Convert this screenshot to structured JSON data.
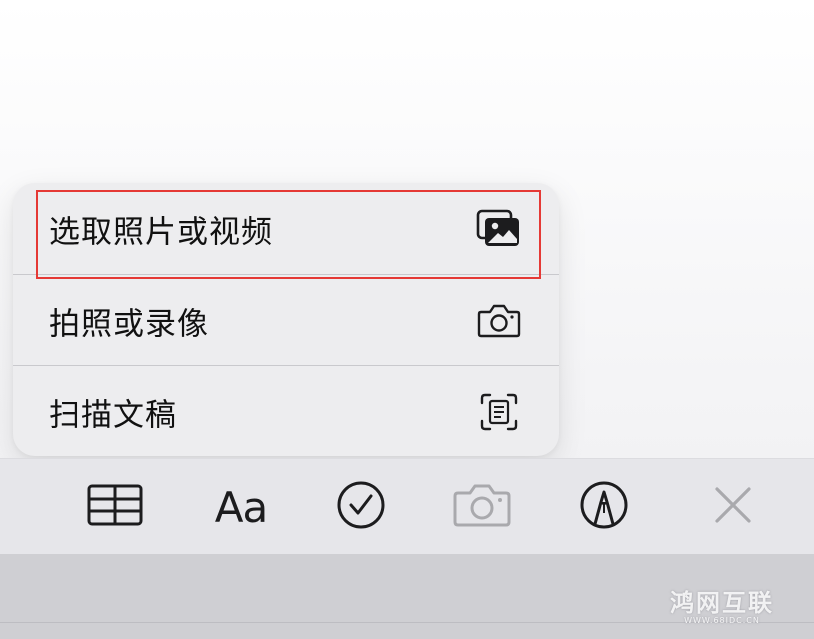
{
  "menu": {
    "items": [
      {
        "label": "选取照片或视频",
        "icon": "photo-library-icon"
      },
      {
        "label": "拍照或录像",
        "icon": "camera-icon"
      },
      {
        "label": "扫描文稿",
        "icon": "scan-document-icon"
      }
    ]
  },
  "toolbar": {
    "buttons": [
      {
        "name": "table",
        "icon": "table-icon"
      },
      {
        "name": "format",
        "icon": "text-format-icon",
        "label": "Aa"
      },
      {
        "name": "checklist",
        "icon": "checkmark-circle-icon"
      },
      {
        "name": "camera",
        "icon": "camera-icon",
        "state": "active-dimmed"
      },
      {
        "name": "markup",
        "icon": "markup-pen-icon"
      },
      {
        "name": "close",
        "icon": "close-icon"
      }
    ]
  },
  "watermark": {
    "main": "鸿网互联",
    "sub": "WWW.68IDC.CN"
  },
  "colors": {
    "highlight": "#e53935",
    "icon": "#1c1c1e",
    "dimmed_icon": "#a9a9ad",
    "menu_bg": "#ededef",
    "toolbar_bg": "#e6e6ea"
  }
}
